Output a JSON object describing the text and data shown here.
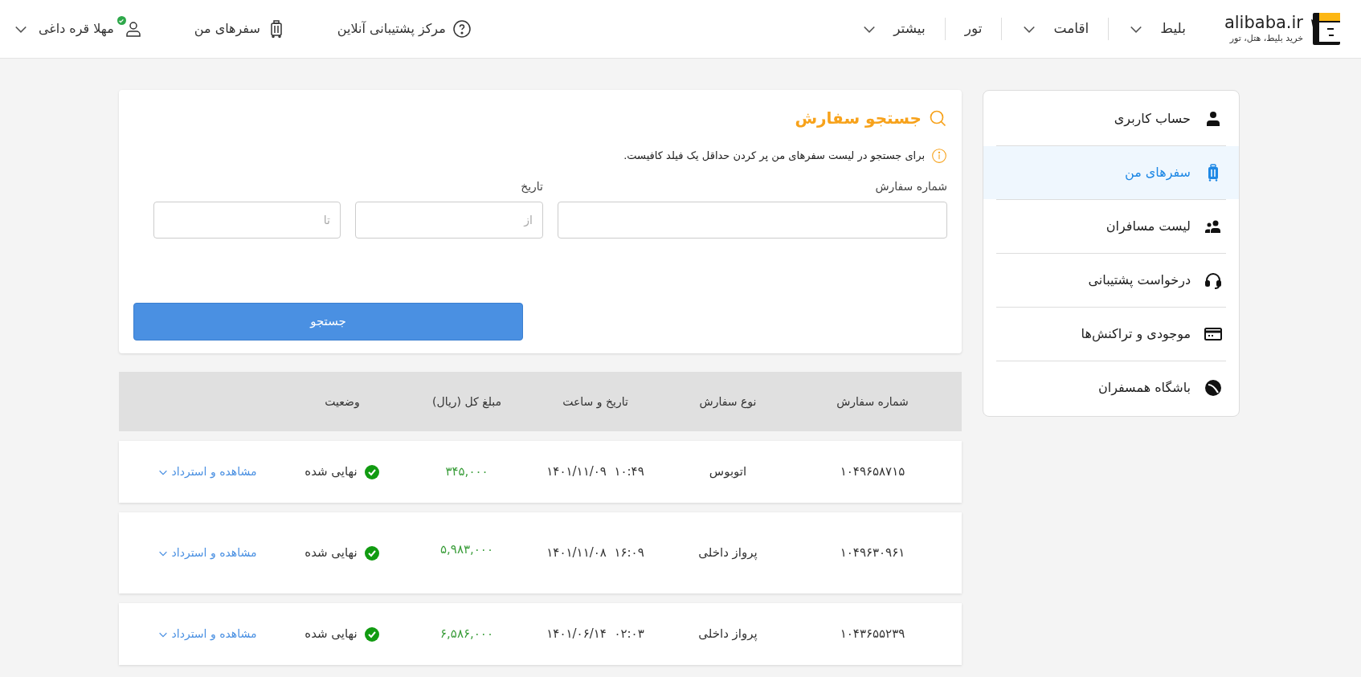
{
  "header": {
    "logo": {
      "name": "alibaba.ir",
      "tagline": "خرید بلیط، هتل، تور"
    },
    "nav": [
      {
        "label": "بلیط",
        "dropdown": true
      },
      {
        "label": "اقامت",
        "dropdown": true
      },
      {
        "label": "تور",
        "dropdown": false
      },
      {
        "label": "بیشتر",
        "dropdown": true
      }
    ],
    "support": "مرکز پشتیبانی آنلاین",
    "my_trips": "سفرهای من",
    "user": {
      "name": "مهلا قره داغی",
      "verified": true
    }
  },
  "sidebar": {
    "items": [
      {
        "label": "حساب کاربری",
        "kind": "user",
        "selected": false
      },
      {
        "label": "سفرهای من",
        "kind": "luggage",
        "selected": true
      },
      {
        "label": "لیست مسافران",
        "kind": "users",
        "selected": false
      },
      {
        "label": "درخواست پشتیبانی",
        "kind": "headset",
        "selected": false
      },
      {
        "label": "موجودی و تراکنش‌ها",
        "kind": "card",
        "selected": false
      },
      {
        "label": "باشگاه همسفران",
        "kind": "club",
        "selected": false
      }
    ]
  },
  "search": {
    "title": "جستجو سفارش",
    "hint": "برای جستجو در لیست سفرهای من پر کردن حداقل یک فیلد کافیست.",
    "order_label": "شماره سفارش",
    "date_label": "تاریخ",
    "from_placeholder": "از",
    "to_placeholder": "تا",
    "button": "جستجو"
  },
  "table": {
    "columns": [
      "شماره سفارش",
      "نوع سفارش",
      "تاریخ و ساعت",
      "مبلغ کل (ریال)",
      "وضعیت"
    ],
    "rows": [
      {
        "order": "۱۰۴۹۶۵۸۷۱۵",
        "type": "اتوبوس",
        "date": "۱۴۰۱/۱۱/۰۹",
        "time": "۱۰:۴۹",
        "amount": "۳۴۵,۰۰۰",
        "status": "نهایی شده",
        "action": "مشاهده و استرداد",
        "tall": false
      },
      {
        "order": "۱۰۴۹۶۳۰۹۶۱",
        "type": "پرواز داخلی",
        "date": "۱۴۰۱/۱۱/۰۸",
        "time": "۱۶:۰۹",
        "amount": "۵,۹۸۳,۰۰۰",
        "status": "نهایی شده",
        "action": "مشاهده و استرداد",
        "tall": true
      },
      {
        "order": "۱۰۴۳۶۵۵۲۳۹",
        "type": "پرواز داخلی",
        "date": "۱۴۰۱/۰۶/۱۴",
        "time": "۰۲:۰۳",
        "amount": "۶,۵۸۶,۰۰۰",
        "status": "نهایی شده",
        "action": "مشاهده و استرداد",
        "tall": false
      }
    ]
  }
}
